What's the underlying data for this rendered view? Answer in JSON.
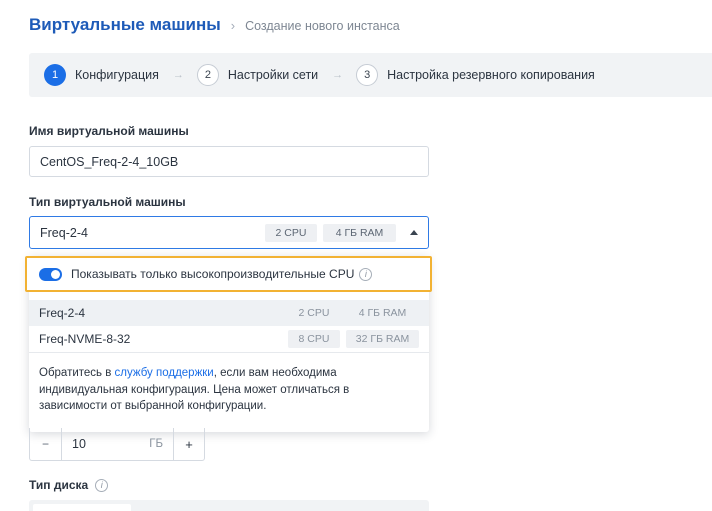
{
  "header": {
    "title": "Виртуальные машины",
    "separator": "›",
    "breadcrumb": "Создание нового инстанса"
  },
  "steps": [
    {
      "num": "1",
      "label": "Конфигурация",
      "state": "active"
    },
    {
      "num": "2",
      "label": "Настройки сети",
      "state": "inactive"
    },
    {
      "num": "3",
      "label": "Настройка резервного копирования",
      "state": "inactive"
    }
  ],
  "step_arrow": "→",
  "vm_name": {
    "label": "Имя виртуальной машины",
    "value": "CentOS_Freq-2-4_10GB"
  },
  "vm_type": {
    "label": "Тип виртуальной машины",
    "value": "Freq-2-4",
    "cpu": "2 CPU",
    "ram": "4 ГБ RAM"
  },
  "dropdown": {
    "toggle_label": "Показывать только высокопроизводительные CPU",
    "toggle_on": true,
    "info_glyph": "i",
    "options": [
      {
        "name": "Freq-2-4",
        "cpu": "2 CPU",
        "ram": "4 ГБ RAM",
        "selected": true
      },
      {
        "name": "Freq-NVME-8-32",
        "cpu": "8 CPU",
        "ram": "32 ГБ RAM",
        "selected": false
      }
    ],
    "note_before": "Обратитесь в ",
    "note_link": "службу поддержки",
    "note_after": ", если вам необходима индивидуальная конфигурация. Цена может отличаться в зависимости от выбранной конфигурации."
  },
  "disk_size": {
    "minus": "−",
    "value": "10",
    "unit": "ГБ",
    "plus": "+"
  },
  "disk_type": {
    "label": "Тип диска",
    "info_glyph": "i"
  },
  "colors": {
    "accent": "#1b6ee6",
    "title": "#1e5bb8",
    "highlight_border": "#f2b233"
  }
}
